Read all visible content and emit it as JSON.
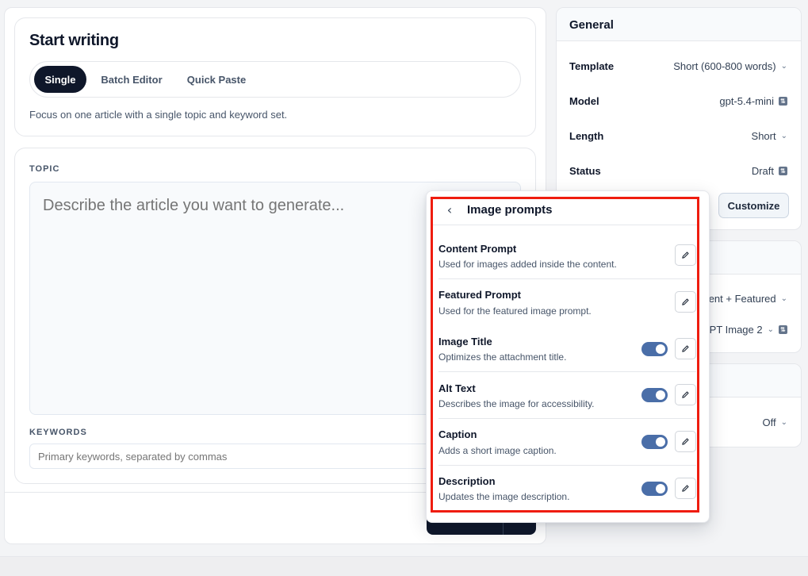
{
  "start": {
    "title": "Start writing",
    "tabs": [
      "Single",
      "Batch Editor",
      "Quick Paste"
    ],
    "active_tab": "Single",
    "description": "Focus on one article with a single topic and keyword set."
  },
  "topic": {
    "label": "TOPIC",
    "placeholder": "Describe the article you want to generate..."
  },
  "keywords": {
    "label": "KEYWORDS",
    "placeholder": "Primary keywords, separated by commas"
  },
  "general": {
    "title": "General",
    "rows": [
      {
        "label": "Template",
        "value": "Short (600-800 words)"
      },
      {
        "label": "Model",
        "value": "gpt-5.4-mini"
      },
      {
        "label": "Length",
        "value": "Short"
      },
      {
        "label": "Status",
        "value": "Draft"
      }
    ],
    "customize_label": "Customize"
  },
  "images_settings": {
    "rows": [
      {
        "value": "ent + Featured"
      },
      {
        "value": "GPT Image 2"
      }
    ]
  },
  "misc_settings": {
    "rows": [
      {
        "value": "Off"
      }
    ]
  },
  "popover": {
    "title": "Image prompts",
    "items": [
      {
        "title": "Content Prompt",
        "description": "Used for images added inside the content.",
        "has_toggle": false
      },
      {
        "title": "Featured Prompt",
        "description": "Used for the featured image prompt.",
        "has_toggle": false
      },
      {
        "title": "Image Title",
        "description": "Optimizes the attachment title.",
        "has_toggle": true,
        "enabled": true
      },
      {
        "title": "Alt Text",
        "description": "Describes the image for accessibility.",
        "has_toggle": true,
        "enabled": true
      },
      {
        "title": "Caption",
        "description": "Adds a short image caption.",
        "has_toggle": true,
        "enabled": true
      },
      {
        "title": "Description",
        "description": "Updates the image description.",
        "has_toggle": true,
        "enabled": true
      }
    ]
  },
  "colors": {
    "primary_dark": "#0f172a",
    "toggle_on": "#4a6ea8",
    "highlight": "#ef1c0f"
  }
}
